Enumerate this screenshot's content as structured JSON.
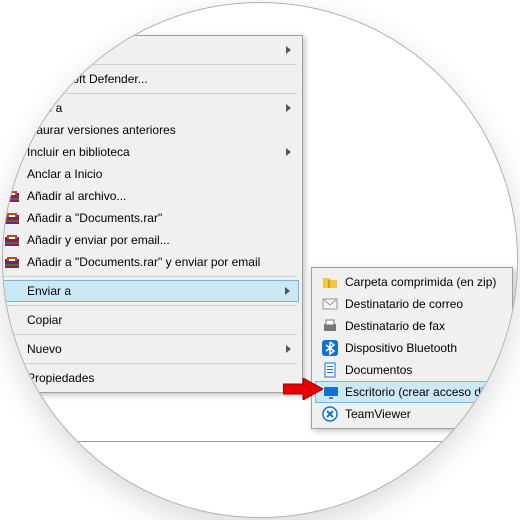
{
  "main_menu": {
    "items": [
      {
        "label": "",
        "has_sub": true
      },
      {
        "sep": true
      },
      {
        "label": "n Microsoft Defender..."
      },
      {
        "sep": true
      },
      {
        "label": "ceso a",
        "has_sub": true
      },
      {
        "label": "staurar versiones anteriores"
      },
      {
        "label": "Incluir en biblioteca",
        "has_sub": true
      },
      {
        "label": "Anclar a Inicio"
      },
      {
        "label": "Añadir al archivo...",
        "icon": "winrar"
      },
      {
        "label": "Añadir a \"Documents.rar\"",
        "icon": "winrar"
      },
      {
        "label": "Añadir y enviar por email...",
        "icon": "winrar"
      },
      {
        "label": "Añadir a \"Documents.rar\" y enviar por email",
        "icon": "winrar"
      },
      {
        "sep": true
      },
      {
        "label": "Enviar a",
        "has_sub": true,
        "hover": true
      },
      {
        "sep": true
      },
      {
        "label": "Copiar"
      },
      {
        "sep": true
      },
      {
        "label": "Nuevo",
        "has_sub": true
      },
      {
        "sep": true
      },
      {
        "label": "Propiedades"
      }
    ]
  },
  "sub_menu": {
    "items": [
      {
        "label": "Carpeta comprimida (en zip)",
        "icon": "zip"
      },
      {
        "label": "Destinatario de correo",
        "icon": "mail"
      },
      {
        "label": "Destinatario de fax",
        "icon": "fax"
      },
      {
        "label": "Dispositivo Bluetooth",
        "icon": "bt"
      },
      {
        "label": "Documentos",
        "icon": "doc"
      },
      {
        "label": "Escritorio (crear acceso directo)",
        "icon": "desktop",
        "hover": true
      },
      {
        "label": "TeamViewer",
        "icon": "tv"
      }
    ]
  }
}
